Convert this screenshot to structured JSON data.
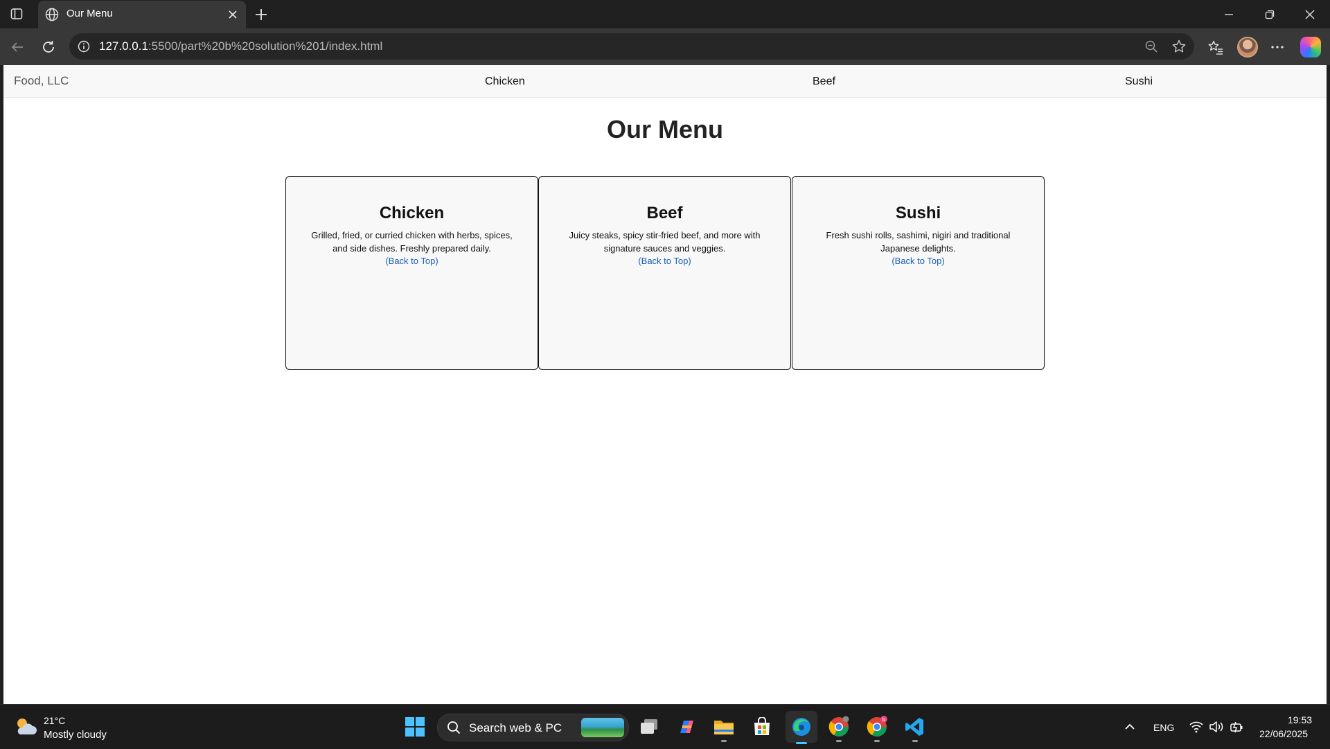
{
  "browser": {
    "tab_title": "Our Menu",
    "url_host": "127.0.0.1",
    "url_rest": ":5500/part%20b%20solution%201/index.html"
  },
  "site": {
    "brand": "Food, LLC",
    "nav": [
      "Chicken",
      "Beef",
      "Sushi"
    ],
    "heading": "Our Menu",
    "cards": [
      {
        "title": "Chicken",
        "description": "Grilled, fried, or curried chicken with herbs, spices, and side dishes. Freshly prepared daily.",
        "link": "(Back to Top)"
      },
      {
        "title": "Beef",
        "description": "Juicy steaks, spicy stir-fried beef, and more with signature sauces and veggies.",
        "link": "(Back to Top)"
      },
      {
        "title": "Sushi",
        "description": "Fresh sushi rolls, sashimi, nigiri and traditional Japanese delights.",
        "link": "(Back to Top)"
      }
    ]
  },
  "taskbar": {
    "weather_temp": "21°C",
    "weather_desc": "Mostly cloudy",
    "search_label": "Search web & PC",
    "language": "ENG",
    "time": "19:53",
    "date": "22/06/2025"
  },
  "icons": {
    "tab_favicon": "globe-icon",
    "back": "arrow-left-icon",
    "reload": "reload-icon",
    "info": "info-icon",
    "zoom": "zoom-out-icon",
    "favorite": "star-icon",
    "favorites_list": "favorites-icon",
    "more": "more-icon"
  },
  "colors": {
    "link": "#1a5fb4",
    "accent": "#4cc2ff"
  }
}
